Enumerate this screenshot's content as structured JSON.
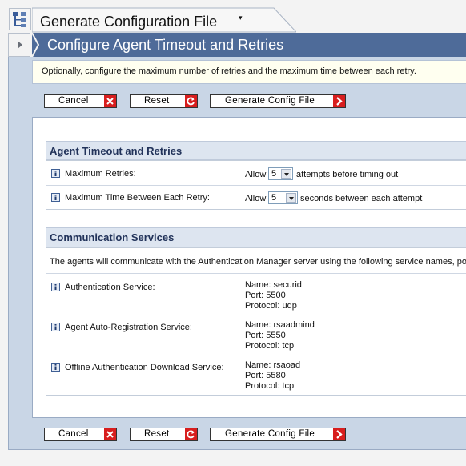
{
  "window": {
    "title": "Generate Configuration File",
    "title_caret": "▾",
    "header": "Configure Agent Timeout and Retries"
  },
  "description": "Optionally, configure the maximum number of retries and the maximum time between each retry.",
  "buttons": {
    "cancel": "Cancel",
    "reset": "Reset",
    "generate": "Generate Config File"
  },
  "timeout_section": {
    "title": "Agent Timeout and Retries",
    "max_retries": {
      "label": "Maximum Retries:",
      "prefix": "Allow",
      "value": "5",
      "suffix": "attempts before timing out"
    },
    "max_time": {
      "label": "Maximum Time Between Each Retry:",
      "prefix": "Allow",
      "value": "5",
      "suffix": "seconds between each attempt"
    }
  },
  "comm_section": {
    "title": "Communication Services",
    "intro": "The agents will communicate with the Authentication Manager server using the following service names, port",
    "services": [
      {
        "label": "Authentication Service:",
        "name": "Name: securid",
        "port": "Port: 5500",
        "protocol": "Protocol: udp"
      },
      {
        "label": "Agent Auto-Registration Service:",
        "name": "Name: rsaadmind",
        "port": "Port: 5550",
        "protocol": "Protocol: tcp"
      },
      {
        "label": "Offline Authentication Download Service:",
        "name": "Name: rsaoad",
        "port": "Port: 5580",
        "protocol": "Protocol: tcp"
      }
    ]
  },
  "colors": {
    "header_bg": "#4e6b99",
    "panel_bg": "#c9d6e6",
    "section_title": "#22335a",
    "button_icon_red": "#d81e1e"
  }
}
